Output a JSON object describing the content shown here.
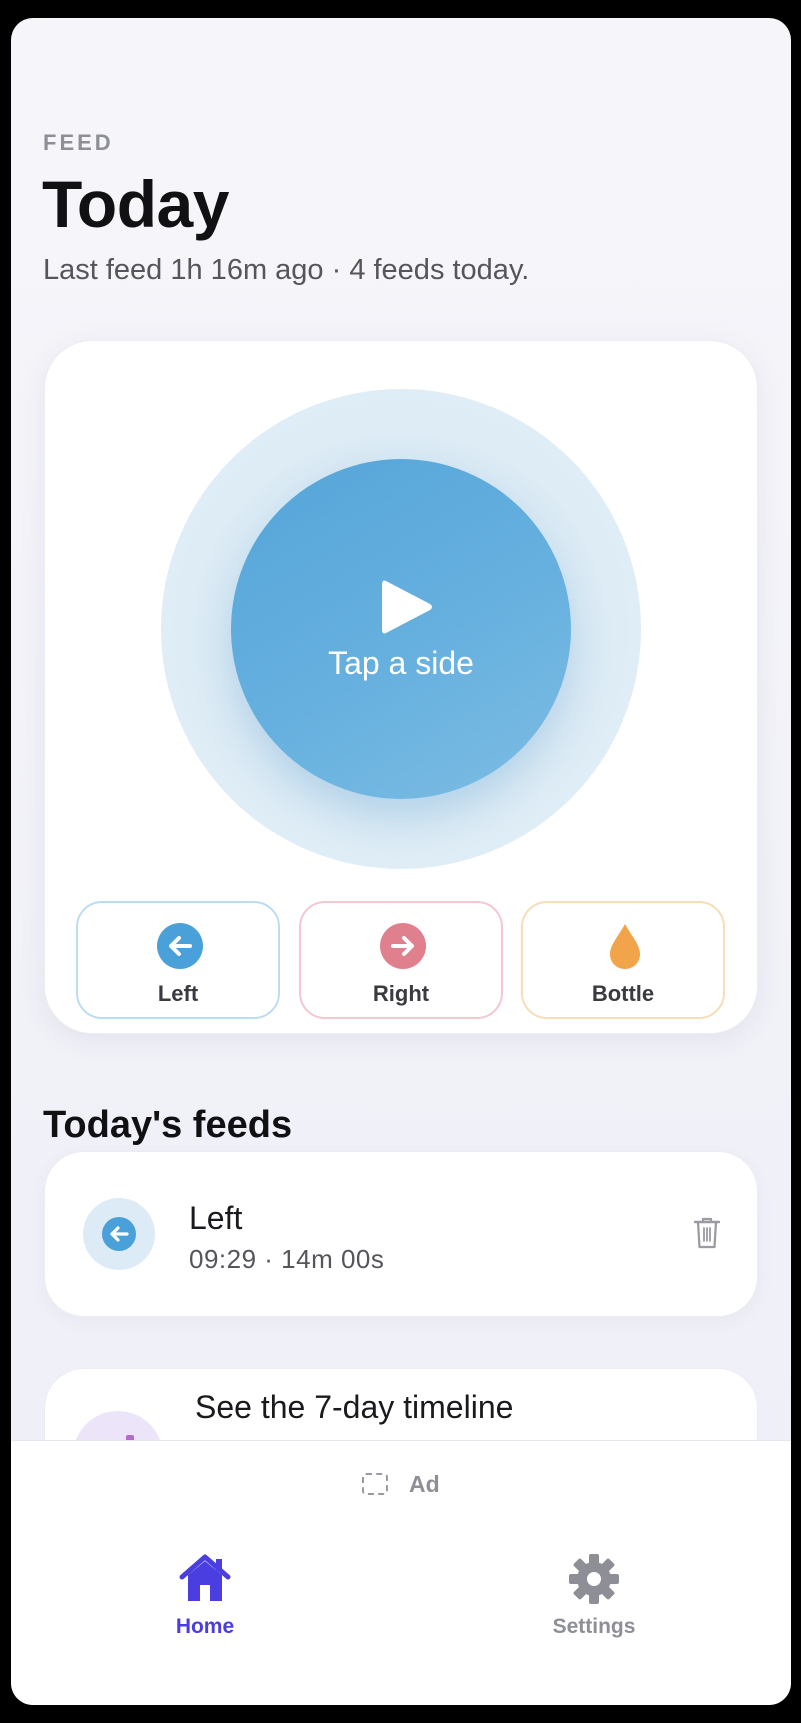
{
  "header": {
    "eyebrow": "FEED",
    "title": "Today",
    "subtitle": "Last feed 1h 16m ago · 4 feeds today."
  },
  "main_button": {
    "icon": "play-icon",
    "label": "Tap a side"
  },
  "sides": [
    {
      "label": "Left",
      "icon": "arrow-left-icon",
      "color": "#4aa0d8"
    },
    {
      "label": "Right",
      "icon": "arrow-right-icon",
      "color": "#e0808e"
    },
    {
      "label": "Bottle",
      "icon": "drop-icon",
      "color": "#f2a44a"
    }
  ],
  "feeds_section": {
    "title": "Today's feeds",
    "items": [
      {
        "side": "Left",
        "meta": "09:29 · 14m 00s",
        "icon": "arrow-left-icon"
      }
    ]
  },
  "timeline_card": {
    "label": "See the 7-day timeline"
  },
  "ad": {
    "label": "Ad"
  },
  "tabs": [
    {
      "label": "Home",
      "icon": "home-icon",
      "active": true,
      "color": "#4a3ee0"
    },
    {
      "label": "Settings",
      "icon": "gear-icon",
      "active": false,
      "color": "#8e8e96"
    }
  ]
}
